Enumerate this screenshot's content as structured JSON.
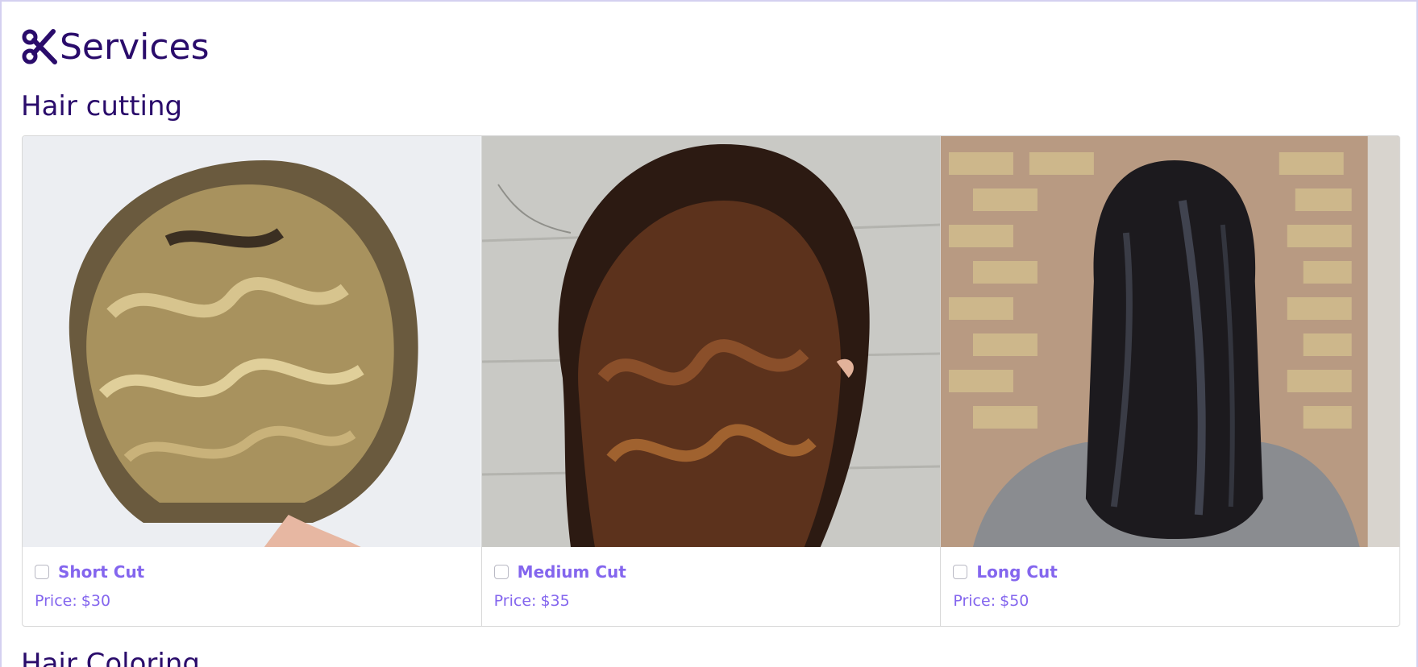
{
  "page": {
    "title": "Services",
    "logo_icon": "scissors-icon",
    "brand_color": "#2a0c6b",
    "accent_color": "#8466ee"
  },
  "sections": [
    {
      "title": "Hair cutting",
      "services": [
        {
          "name": "Short Cut",
          "price_label": "Price:",
          "price": "$30",
          "checked": false,
          "image_icon": "short-bob-hair-photo"
        },
        {
          "name": "Medium Cut",
          "price_label": "Price:",
          "price": "$35",
          "checked": false,
          "image_icon": "medium-wavy-hair-photo"
        },
        {
          "name": "Long Cut",
          "price_label": "Price:",
          "price": "$50",
          "checked": false,
          "image_icon": "long-straight-hair-photo"
        }
      ]
    },
    {
      "title": "Hair Coloring"
    }
  ]
}
